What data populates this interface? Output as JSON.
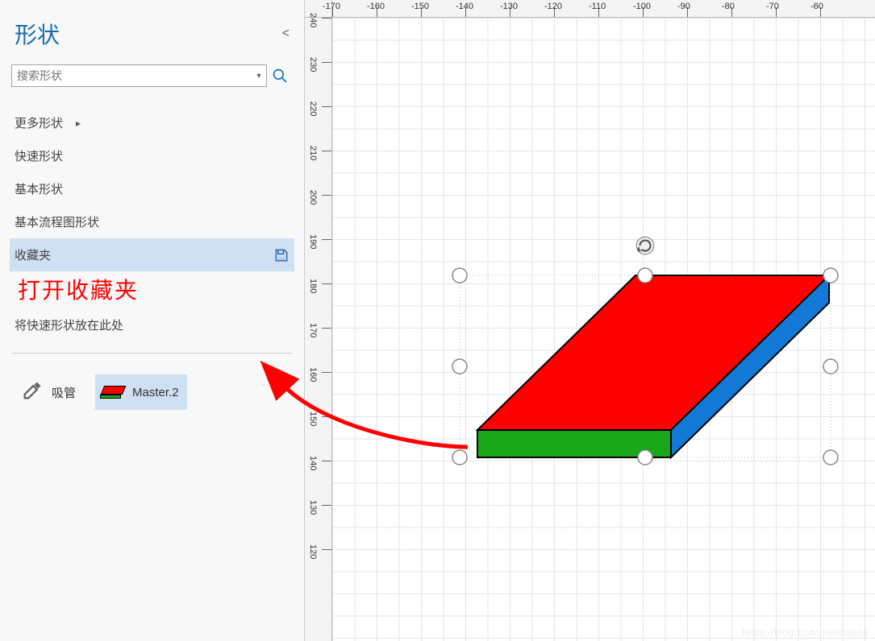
{
  "sidebar": {
    "title": "形状",
    "search_placeholder": "搜索形状",
    "categories": {
      "more": "更多形状",
      "quick": "快速形状",
      "basic": "基本形状",
      "flowchart": "基本流程图形状",
      "favorites": "收藏夹"
    },
    "annotation": "打开收藏夹",
    "hint": "将快速形状放在此处",
    "items": {
      "eyedropper": "吸管",
      "master2": "Master.2"
    }
  },
  "ruler": {
    "h_ticks": [
      "-170",
      "-160",
      "-150",
      "-140",
      "-130",
      "-120",
      "-110",
      "-100",
      "-90",
      "-80",
      "-70",
      "-60"
    ],
    "v_ticks": [
      "240",
      "230",
      "220",
      "210",
      "200",
      "190",
      "180",
      "170",
      "160",
      "150",
      "140",
      "130",
      "120"
    ]
  },
  "canvas_shape": {
    "name": "3D-block",
    "colors": {
      "top": "#ff0000",
      "front": "#1aa81a",
      "side": "#1379d6"
    }
  },
  "watermark": "https://blog.csdn.net/coppa"
}
